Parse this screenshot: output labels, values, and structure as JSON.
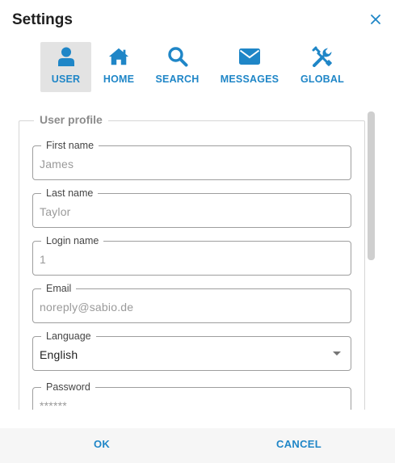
{
  "dialog": {
    "title": "Settings",
    "close_icon": "close-icon"
  },
  "tabs": [
    {
      "label": "USER",
      "icon": "user-icon",
      "active": true
    },
    {
      "label": "HOME",
      "icon": "home-icon",
      "active": false
    },
    {
      "label": "SEARCH",
      "icon": "search-icon",
      "active": false
    },
    {
      "label": "MESSAGES",
      "icon": "envelope-icon",
      "active": false
    },
    {
      "label": "GLOBAL",
      "icon": "tools-icon",
      "active": false
    }
  ],
  "profile": {
    "legend": "User profile",
    "fields": [
      {
        "label": "First name",
        "value": "James"
      },
      {
        "label": "Last name",
        "value": "Taylor"
      },
      {
        "label": "Login name",
        "value": "1"
      },
      {
        "label": "Email",
        "value": "noreply@sabio.de"
      },
      {
        "label": "Language",
        "value": "English"
      },
      {
        "label": "Password",
        "value": "******"
      }
    ]
  },
  "footer": {
    "ok_label": "OK",
    "cancel_label": "CANCEL"
  },
  "colors": {
    "accent": "#1f86c7",
    "active_tab_bg": "#e3e3e3",
    "footer_bg": "#f6f6f6"
  }
}
